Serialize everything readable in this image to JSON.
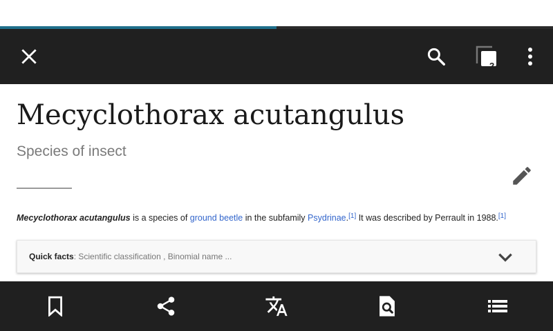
{
  "colors": {
    "toolbar_bg": "#202020",
    "progress": "#1f6f8b",
    "link": "#3366cc",
    "icon_light": "#ffffff",
    "icon_dark": "#555555"
  },
  "progress": {
    "fraction": 0.5
  },
  "toolbar": {
    "close_icon": "close-icon",
    "search_icon": "search-icon",
    "tabs_icon": "tabs-icon",
    "tab_count": "2",
    "overflow_icon": "more-vert-icon"
  },
  "article": {
    "title": "Mecyclothorax acutangulus",
    "description": "Species of insect",
    "edit_icon": "pencil-icon",
    "paragraph": {
      "subject": "Mecyclothorax acutangulus",
      "text1": " is a species of ",
      "link1": "ground beetle",
      "text2": " in the subfamily ",
      "link2": "Psydrinae",
      "text3": ".",
      "ref1": "[1]",
      "text4": " It was described by Perrault in 1988.",
      "ref2": "[1]"
    },
    "quick_facts": {
      "label": "Quick facts",
      "summary": ": Scientific classification , Binomial name ..."
    }
  },
  "bottom_bar": [
    {
      "icon": "bookmark-icon"
    },
    {
      "icon": "share-icon"
    },
    {
      "icon": "translate-icon"
    },
    {
      "icon": "find-in-page-icon"
    },
    {
      "icon": "table-of-contents-icon"
    }
  ]
}
